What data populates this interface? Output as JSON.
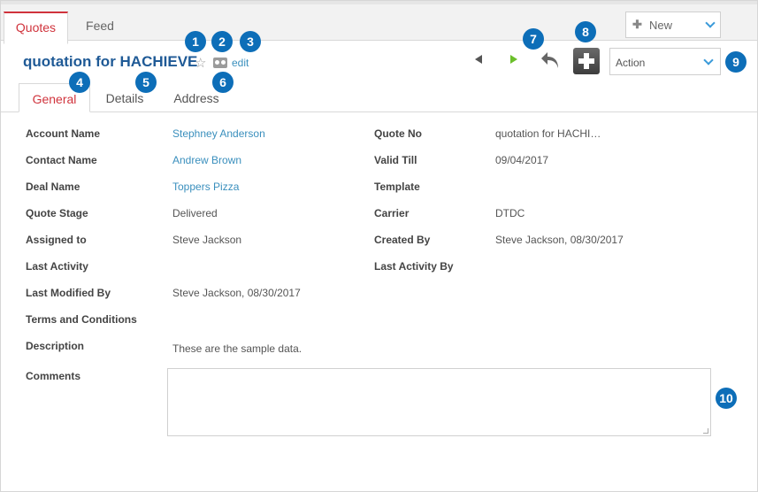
{
  "top_tabs": {
    "quotes": "Quotes",
    "feed": "Feed"
  },
  "new_button": {
    "label": "New"
  },
  "record": {
    "title": "quotation for HACHIEVE",
    "edit_label": "edit"
  },
  "action_select": {
    "label": "Action"
  },
  "sub_tabs": {
    "general": "General",
    "details": "Details",
    "address": "Address"
  },
  "badges": [
    "1",
    "2",
    "3",
    "4",
    "5",
    "6",
    "7",
    "8",
    "9",
    "10"
  ],
  "fields_left": [
    {
      "label": "Account Name",
      "value": "Stephney Anderson"
    },
    {
      "label": "Contact Name",
      "value": "Andrew Brown"
    },
    {
      "label": "Deal Name",
      "value": "Toppers Pizza"
    },
    {
      "label": "Quote Stage",
      "value": "Delivered"
    },
    {
      "label": "Assigned to",
      "value": "Steve Jackson"
    },
    {
      "label": "Last Activity",
      "value": ""
    },
    {
      "label": "Last Modified By",
      "value": "Steve Jackson, 08/30/2017"
    },
    {
      "label": "Terms and Conditions",
      "value": ""
    },
    {
      "label": "Description",
      "value": "These are the sample data."
    },
    {
      "label": "Comments",
      "value": ""
    }
  ],
  "fields_right": [
    {
      "label": "Quote No",
      "value": "quotation for HACHI…"
    },
    {
      "label": "Valid Till",
      "value": "09/04/2017"
    },
    {
      "label": "Template",
      "value": ""
    },
    {
      "label": "Carrier",
      "value": "DTDC"
    },
    {
      "label": "Created By",
      "value": "Steve Jackson, 08/30/2017"
    },
    {
      "label": "Last Activity By",
      "value": ""
    }
  ],
  "colors": {
    "accent": "#d0333c",
    "link": "#3a8fbd",
    "title": "#1f5a96",
    "badge": "#0d6eb8",
    "next": "#6bbf2b"
  }
}
